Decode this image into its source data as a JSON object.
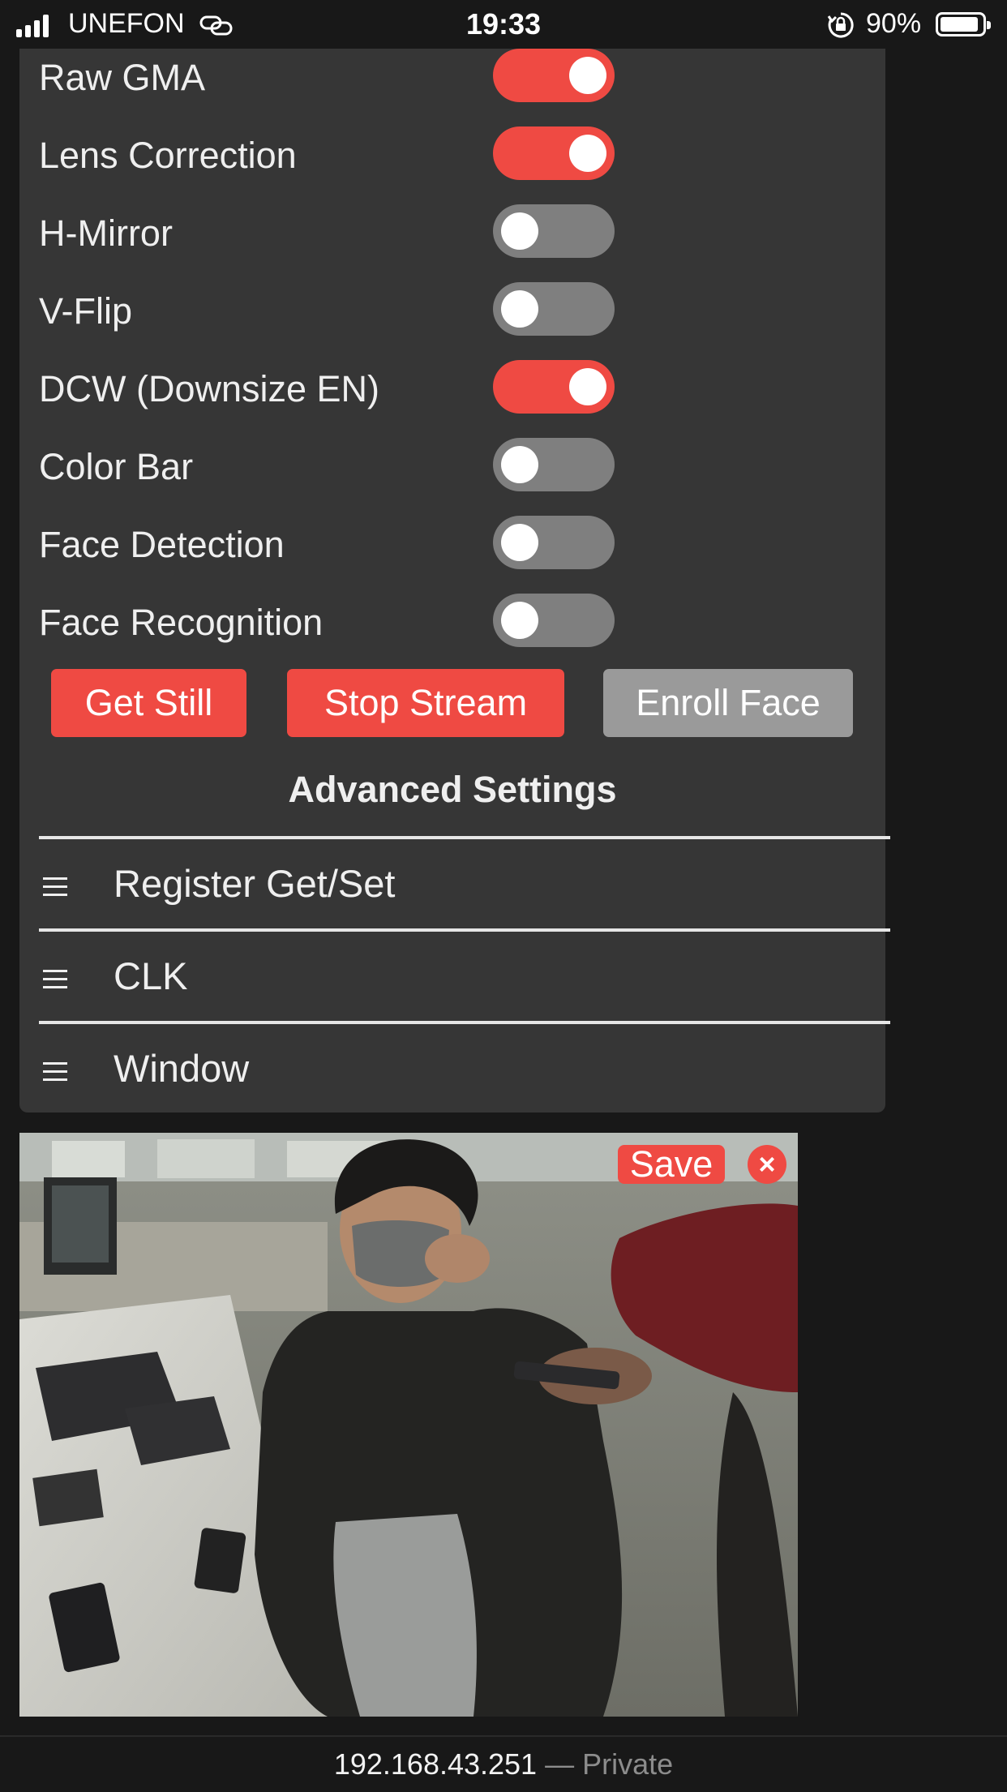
{
  "status_bar": {
    "carrier": "UNEFON",
    "time": "19:33",
    "battery": "90%",
    "battery_level": 0.9
  },
  "toggles": [
    {
      "label": "Raw GMA",
      "on": true
    },
    {
      "label": "Lens Correction",
      "on": true
    },
    {
      "label": "H-Mirror",
      "on": false
    },
    {
      "label": "V-Flip",
      "on": false
    },
    {
      "label": "DCW (Downsize EN)",
      "on": true
    },
    {
      "label": "Color Bar",
      "on": false
    },
    {
      "label": "Face Detection",
      "on": false
    },
    {
      "label": "Face Recognition",
      "on": false
    }
  ],
  "buttons": {
    "get_still": "Get Still",
    "stop_stream": "Stop Stream",
    "enroll_face": "Enroll Face"
  },
  "advanced": {
    "title": "Advanced Settings",
    "sections": [
      "Register Get/Set",
      "CLK",
      "Window"
    ]
  },
  "stream": {
    "save_label": "Save",
    "close_label": "×"
  },
  "url_bar": {
    "host": "192.168.43.251",
    "separator": "—",
    "mode": "Private"
  },
  "colors": {
    "accent": "#ef4a43",
    "panel": "#363636",
    "background": "#181818",
    "toggle_off": "#7f7f7f"
  }
}
